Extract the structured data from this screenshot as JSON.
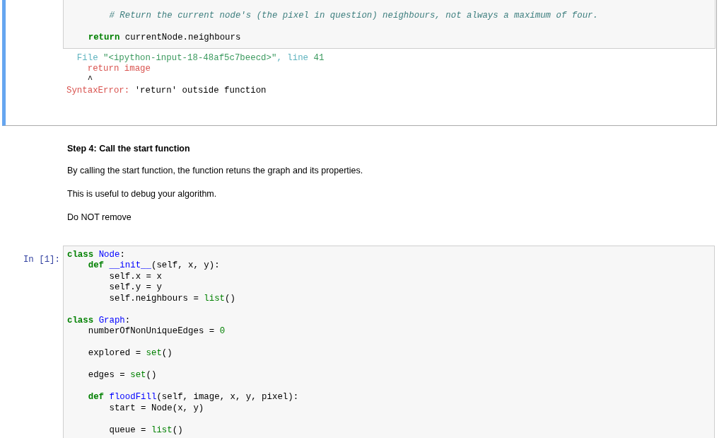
{
  "cells": [
    {
      "kind": "code",
      "selected": true,
      "code": [
        {
          "children": [
            {
              "children": [
                {
                  "tokens": [
                    {
                      "text": "# Return the current node's (the pixel in question) neighbours, not always a maximum of four.",
                      "kind": "comment"
                    }
                  ]
                }
              ]
            },
            {
              "gap_before": true,
              "tokens": [
                {
                  "text": "return ",
                  "kind": "keyword"
                },
                {
                  "text": "currentNode.neighbours",
                  "kind": "plain"
                }
              ]
            }
          ]
        }
      ],
      "output": [
        {
          "children": [
            {
              "tokens": [
                {
                  "text": "File ",
                  "kind": "cyan"
                },
                {
                  "text": "\"<ipython-input-18-48af5c7beecd>\"",
                  "kind": "green"
                },
                {
                  "text": ", line ",
                  "kind": "cyan"
                },
                {
                  "text": "41",
                  "kind": "green"
                }
              ],
              "children": [
                {
                  "tokens": [
                    {
                      "text": "return image",
                      "kind": "red"
                    }
                  ]
                },
                {
                  "tokens": [
                    {
                      "text": "^",
                      "kind": "plain"
                    }
                  ]
                }
              ]
            }
          ]
        },
        {
          "tokens": [
            {
              "text": "SyntaxError:",
              "kind": "red"
            },
            {
              "text": " 'return' outside function",
              "kind": "plain"
            }
          ]
        }
      ]
    },
    {
      "kind": "markdown",
      "selected": false,
      "heading": "Step 4: Call the start function",
      "paragraphs": [
        "By calling the start function, the function retuns the graph and its properties.",
        "This is useful to debug your algorithm.",
        "Do NOT remove"
      ]
    },
    {
      "kind": "code",
      "selected": false,
      "prompt": "In [1]:",
      "code": [
        {
          "tokens": [
            {
              "text": "class ",
              "kind": "keyword"
            },
            {
              "text": "Node",
              "kind": "name"
            },
            {
              "text": ":",
              "kind": "plain"
            }
          ],
          "children": [
            {
              "tokens": [
                {
                  "text": "def ",
                  "kind": "keyword"
                },
                {
                  "text": "__init__",
                  "kind": "name"
                },
                {
                  "text": "(self, x, y):",
                  "kind": "plain"
                }
              ],
              "children": [
                {
                  "tokens": [
                    {
                      "text": "self.x = x",
                      "kind": "plain"
                    }
                  ]
                },
                {
                  "tokens": [
                    {
                      "text": "self.y = y",
                      "kind": "plain"
                    }
                  ]
                },
                {
                  "tokens": [
                    {
                      "text": "self.neighbours = ",
                      "kind": "plain"
                    },
                    {
                      "text": "list",
                      "kind": "builtin"
                    },
                    {
                      "text": "()",
                      "kind": "plain"
                    }
                  ]
                }
              ]
            }
          ]
        },
        {
          "gap_before": true,
          "tokens": [
            {
              "text": "class ",
              "kind": "keyword"
            },
            {
              "text": "Graph",
              "kind": "name"
            },
            {
              "text": ":",
              "kind": "plain"
            }
          ],
          "children": [
            {
              "tokens": [
                {
                  "text": "numberOfNonUniqueEdges = ",
                  "kind": "plain"
                },
                {
                  "text": "0",
                  "kind": "builtin"
                }
              ]
            },
            {
              "gap_before": true,
              "tokens": [
                {
                  "text": "explored = ",
                  "kind": "plain"
                },
                {
                  "text": "set",
                  "kind": "builtin"
                },
                {
                  "text": "()",
                  "kind": "plain"
                }
              ]
            },
            {
              "gap_before": true,
              "tokens": [
                {
                  "text": "edges = ",
                  "kind": "plain"
                },
                {
                  "text": "set",
                  "kind": "builtin"
                },
                {
                  "text": "()",
                  "kind": "plain"
                }
              ]
            },
            {
              "gap_before": true,
              "tokens": [
                {
                  "text": "def ",
                  "kind": "keyword"
                },
                {
                  "text": "floodFill",
                  "kind": "name"
                },
                {
                  "text": "(self, image, x, y, pixel):",
                  "kind": "plain"
                }
              ],
              "children": [
                {
                  "tokens": [
                    {
                      "text": "start = Node(x, y)",
                      "kind": "plain"
                    }
                  ]
                },
                {
                  "gap_before": true,
                  "tokens": [
                    {
                      "text": "queue = ",
                      "kind": "plain"
                    },
                    {
                      "text": "list",
                      "kind": "builtin"
                    },
                    {
                      "text": "()",
                      "kind": "plain"
                    }
                  ]
                }
              ]
            }
          ]
        }
      ]
    }
  ]
}
